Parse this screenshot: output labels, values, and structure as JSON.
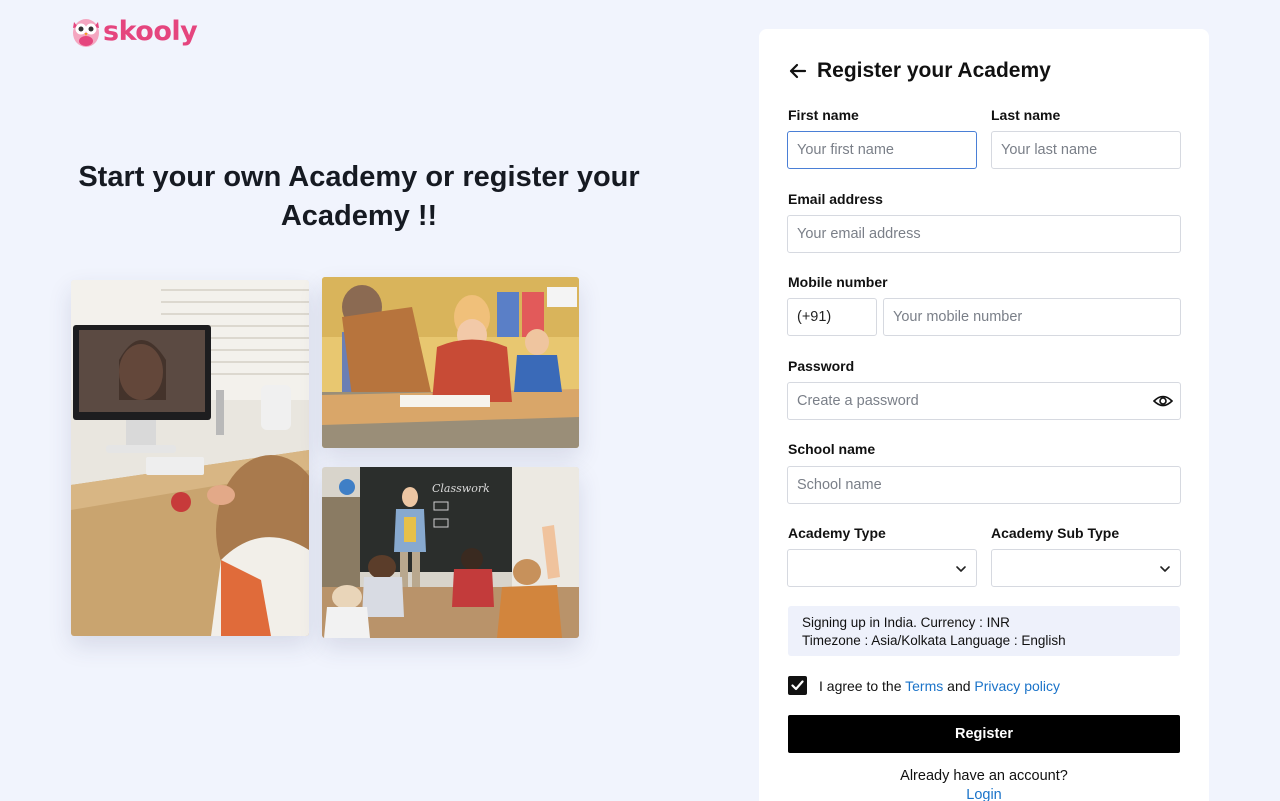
{
  "brand": {
    "name": "skooly",
    "color": "#e5457e"
  },
  "hero": {
    "title": "Start your own Academy or register your Academy !!"
  },
  "photos": [
    {
      "icon": "online-class-photo"
    },
    {
      "icon": "classroom-students-photo"
    },
    {
      "icon": "teacher-chalkboard-photo"
    }
  ],
  "form": {
    "title": "Register your Academy",
    "first_name": {
      "label": "First name",
      "placeholder": "Your first name"
    },
    "last_name": {
      "label": "Last name",
      "placeholder": "Your last name"
    },
    "email": {
      "label": "Email address",
      "placeholder": "Your email address"
    },
    "mobile": {
      "label": "Mobile number",
      "country_code": "(+91)",
      "placeholder": "Your mobile number"
    },
    "password": {
      "label": "Password",
      "placeholder": "Create a password"
    },
    "school": {
      "label": "School name",
      "placeholder": "School name"
    },
    "academy_type": {
      "label": "Academy Type",
      "value": ""
    },
    "academy_sub_type": {
      "label": "Academy Sub Type",
      "value": ""
    },
    "info": {
      "line1": "Signing up in India.  Currency : INR",
      "line2": "Timezone : Asia/Kolkata  Language : English"
    },
    "agree": {
      "checked": true,
      "prefix": "I agree to the ",
      "terms": "Terms",
      "and": " and ",
      "privacy": "Privacy policy"
    },
    "register_label": "Register",
    "already_text": "Already have an account?",
    "login_label": "Login"
  },
  "colors": {
    "accent": "#1a73c9",
    "focus_border": "#4a7fd6",
    "background": "#f1f4fd"
  }
}
